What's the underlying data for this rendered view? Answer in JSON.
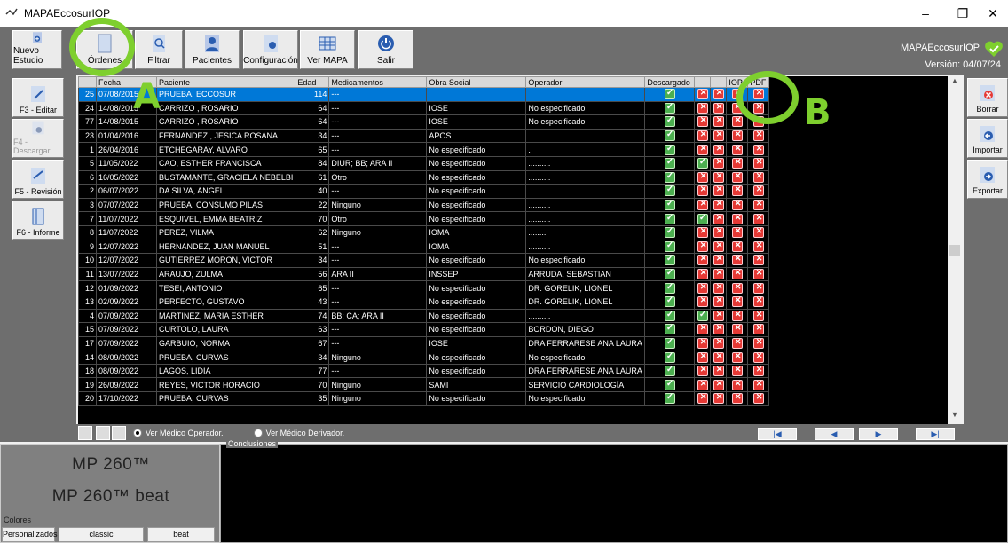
{
  "window": {
    "title": "MAPAEccosurIOP",
    "minimize": "–",
    "maximize": "❐",
    "close": "✕"
  },
  "toolbar": {
    "buttons": [
      "Nuevo Estudio",
      "Órdenes",
      "Filtrar",
      "Pacientes",
      "Configuración",
      "Ver MAPA",
      "Salir"
    ]
  },
  "brand": {
    "name": "MAPAEccosurIOP",
    "version": "Versión: 04/07/24"
  },
  "left_panel": [
    "F3 - Editar",
    "F4 - Descargar",
    "F5 - Revisión",
    "F6 - Informe"
  ],
  "right_panel": [
    "Borrar",
    "Importar",
    "Exportar"
  ],
  "table": {
    "columns": [
      "",
      "Fecha",
      "Paciente",
      "Edad",
      "Medicamentos",
      "Obra Social",
      "Operador",
      "Descargado",
      "",
      "",
      "IOP",
      "PDF"
    ],
    "rows": [
      [
        "25",
        "07/08/2015",
        "PRUEBA, ECCOSUR",
        "114",
        "---",
        "",
        "",
        "ok",
        "no",
        "no",
        "no",
        "no"
      ],
      [
        "24",
        "14/08/2015",
        "CARRIZO , ROSARIO",
        "64",
        "---",
        "IOSE",
        "No especificado",
        "ok",
        "no",
        "no",
        "no",
        "no"
      ],
      [
        "77",
        "14/08/2015",
        "CARRIZO , ROSARIO",
        "64",
        "---",
        "IOSE",
        "No especificado",
        "ok",
        "no",
        "no",
        "no",
        "no"
      ],
      [
        "23",
        "01/04/2016",
        "FERNANDEZ , JESICA ROSANA",
        "34",
        "---",
        "APOS",
        "",
        "ok",
        "no",
        "no",
        "no",
        "no"
      ],
      [
        "1",
        "26/04/2016",
        "ETCHEGARAY, ALVARO",
        "65",
        "---",
        "No especificado",
        ".",
        "ok",
        "no",
        "no",
        "no",
        "no"
      ],
      [
        "5",
        "11/05/2022",
        "CAO, ESTHER FRANCISCA",
        "84",
        "DIUR; BB; ARA II",
        "No especificado",
        "..........",
        "ok",
        "ok",
        "no",
        "no",
        "no"
      ],
      [
        "6",
        "16/05/2022",
        "BUSTAMANTE, GRACIELA NEBELBI",
        "61",
        "Otro",
        "No especificado",
        "..........",
        "ok",
        "no",
        "no",
        "no",
        "no"
      ],
      [
        "2",
        "06/07/2022",
        "DA SILVA, ANGEL",
        "40",
        "---",
        "No especificado",
        "...",
        "ok",
        "no",
        "no",
        "no",
        "no"
      ],
      [
        "3",
        "07/07/2022",
        "PRUEBA, CONSUMO PILAS",
        "22",
        "Ninguno",
        "No especificado",
        "..........",
        "ok",
        "no",
        "no",
        "no",
        "no"
      ],
      [
        "7",
        "11/07/2022",
        "ESQUIVEL, EMMA BEATRIZ",
        "70",
        "Otro",
        "No especificado",
        "..........",
        "ok",
        "ok",
        "no",
        "no",
        "no"
      ],
      [
        "8",
        "11/07/2022",
        "PEREZ, VILMA",
        "62",
        "Ninguno",
        "IOMA",
        "........",
        "ok",
        "no",
        "no",
        "no",
        "no"
      ],
      [
        "9",
        "12/07/2022",
        "HERNANDEZ, JUAN MANUEL",
        "51",
        "---",
        "IOMA",
        "..........",
        "ok",
        "no",
        "no",
        "no",
        "no"
      ],
      [
        "10",
        "12/07/2022",
        "GUTIERREZ MORON, VICTOR",
        "34",
        "---",
        "No especificado",
        "No especificado",
        "ok",
        "no",
        "no",
        "no",
        "no"
      ],
      [
        "11",
        "13/07/2022",
        "ARAUJO, ZULMA",
        "56",
        "ARA II",
        "INSSEP",
        "ARRUDA, SEBASTIAN",
        "ok",
        "no",
        "no",
        "no",
        "no"
      ],
      [
        "12",
        "01/09/2022",
        "TESEI, ANTONIO",
        "65",
        "---",
        "No especificado",
        "DR. GORELIK, LIONEL",
        "ok",
        "no",
        "no",
        "no",
        "no"
      ],
      [
        "13",
        "02/09/2022",
        "PERFECTO, GUSTAVO",
        "43",
        "---",
        "No especificado",
        "DR. GORELIK, LIONEL",
        "ok",
        "no",
        "no",
        "no",
        "no"
      ],
      [
        "4",
        "07/09/2022",
        "MARTINEZ, MARIA ESTHER",
        "74",
        "BB; CA; ARA II",
        "No especificado",
        "..........",
        "ok",
        "ok",
        "no",
        "no",
        "no"
      ],
      [
        "15",
        "07/09/2022",
        "CURTOLO, LAURA",
        "63",
        "---",
        "No especificado",
        "BORDON, DIEGO",
        "ok",
        "no",
        "no",
        "no",
        "no"
      ],
      [
        "17",
        "07/09/2022",
        "GARBUIO, NORMA",
        "67",
        "---",
        "IOSE",
        "DRA FERRARESE ANA LAURA",
        "ok",
        "no",
        "no",
        "no",
        "no"
      ],
      [
        "14",
        "08/09/2022",
        "PRUEBA, CURVAS",
        "34",
        "Ninguno",
        "No especificado",
        "No especificado",
        "ok",
        "no",
        "no",
        "no",
        "no"
      ],
      [
        "18",
        "08/09/2022",
        "LAGOS, LIDIA",
        "77",
        "---",
        "No especificado",
        "DRA FERRARESE ANA LAURA",
        "ok",
        "no",
        "no",
        "no",
        "no"
      ],
      [
        "19",
        "26/09/2022",
        "REYES, VICTOR HORACIO",
        "70",
        "Ninguno",
        "SAMI",
        "SERVICIO CARDIOLOGÍA",
        "ok",
        "no",
        "no",
        "no",
        "no"
      ],
      [
        "20",
        "17/10/2022",
        "PRUEBA, CURVAS",
        "35",
        "Ninguno",
        "No especificado",
        "No especificado",
        "ok",
        "no",
        "no",
        "no",
        "no"
      ]
    ]
  },
  "bottom": {
    "radio_operator": "Ver Médico Operador.",
    "radio_referrer": "Ver Médico Derivador.",
    "nav": [
      "|◀",
      "◀",
      "▶",
      "▶|"
    ]
  },
  "device": {
    "model1": "MP 260™",
    "model2": "MP 260™ beat"
  },
  "colors": {
    "label": "Colores",
    "buttons": [
      "Personalizados",
      "classic",
      "beat"
    ]
  },
  "conclusions": {
    "label": "Conclusiones"
  },
  "annotations": {
    "a": "A",
    "b": "B"
  }
}
